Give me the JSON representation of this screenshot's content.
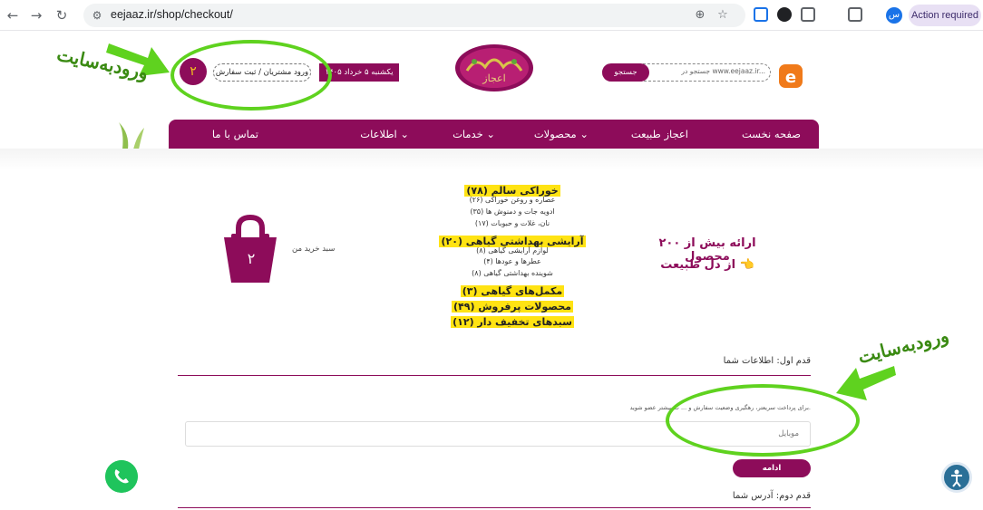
{
  "browser": {
    "url": "eejaaz.ir/shop/checkout/",
    "profile_initial": "س",
    "action_label": "Action required"
  },
  "header": {
    "cart_count": "۲",
    "login_label": "ورود مشتریان / ثبت سفارش",
    "date_label": "یکشنبه ۵ خرداد ۱۴۰۵",
    "search_button": "جستجو",
    "search_placeholder": "جستجو در www.eejaaz.ir...",
    "logo_text": "اعجاز"
  },
  "nav": {
    "home": "صفحه نخست",
    "nature": "اعجاز طبیعت",
    "products": "محصولات ⌄",
    "services": "خدمات ⌄",
    "info": "اطلاعات ⌄",
    "contact": "تماس با ما"
  },
  "catalog": [
    {
      "label": "خوراکی سالم (۷۸)",
      "big": true
    },
    {
      "label": "عصاره و روغن خوراکی (۲۶)",
      "big": false
    },
    {
      "label": "ادویه جات و دمنوش ها (۳۵)",
      "big": false
    },
    {
      "label": "نان، غلات و حبوبات (۱۷)",
      "big": false
    },
    {
      "label": "آرایشی بهداشتی گیاهی (۲۰)",
      "big": true
    },
    {
      "label": "لوازم آرایشی گیاهی (۸)",
      "big": false
    },
    {
      "label": "عطرها و عودها (۴)",
      "big": false
    },
    {
      "label": "شوینده بهداشتی گیاهی (۸)",
      "big": false
    },
    {
      "label": "مکمل‌های گیاهی (۳)",
      "big": true
    },
    {
      "label": "محصولات پرفروش (۴۹)",
      "big": true
    },
    {
      "label": "سبدهای تخفیف دار (۱۲)",
      "big": true
    }
  ],
  "cart": {
    "count": "۲",
    "label": "سبد خرید من"
  },
  "promo": {
    "line1": "ارائه بیش از ۲۰۰ محصول",
    "line2": "از دل طبیعت",
    "hand": "👈"
  },
  "checkout": {
    "step1": "قدم اول: اطلاعات شما",
    "instruction": "برای پرداخت سریعتر، رهگیری وضعیت سفارش و ... ت بیشتر عضو شوید.",
    "mobile_placeholder": "موبایل",
    "continue_label": "ادامه",
    "step2": "قدم دوم: آدرس شما"
  },
  "annotations": {
    "label1": "ورودبه‌سایت",
    "label2": "ورودبه‌سایت"
  },
  "colors": {
    "brand": "#8d0c5a",
    "highlight": "#ffe313",
    "annotation": "#5fd21f"
  }
}
